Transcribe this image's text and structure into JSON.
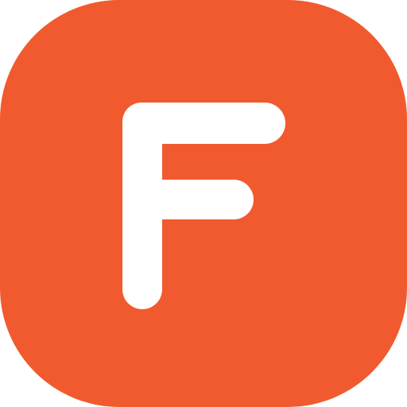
{
  "icon": {
    "name": "f-letter-app-icon",
    "letter": "F",
    "background_color": "#F15A2E",
    "glyph_color": "#FFFFFF"
  }
}
